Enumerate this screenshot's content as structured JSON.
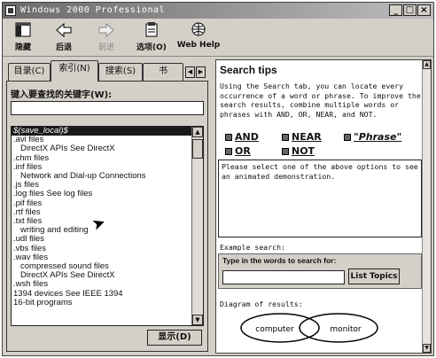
{
  "window": {
    "title": "Windows 2000 Professional",
    "controls": [
      "_",
      "□",
      "×"
    ]
  },
  "toolbar": [
    {
      "label": "隐藏",
      "icon": "hide-pane-icon",
      "enabled": true
    },
    {
      "label": "后退",
      "icon": "back-arrow-icon",
      "enabled": true
    },
    {
      "label": "前进",
      "icon": "forward-arrow-icon",
      "enabled": false
    },
    {
      "label": "选项(O)",
      "icon": "options-icon",
      "enabled": true
    },
    {
      "label": "Web Help",
      "icon": "web-help-icon",
      "enabled": true
    }
  ],
  "tabs": [
    "目录(C)",
    "索引(N)",
    "搜索(S)",
    "书"
  ],
  "index": {
    "keyword_label": "键入要查找的关键字(W):",
    "keyword_value": "",
    "items": [
      {
        "text": "$(save_local)$",
        "level": 0,
        "selected": true
      },
      {
        "text": ".avi files",
        "level": 0
      },
      {
        "text": "DirectX APIs See DirectX",
        "level": 1
      },
      {
        "text": ".chm files",
        "level": 0
      },
      {
        "text": ".inf files",
        "level": 0
      },
      {
        "text": "Network and Dial-up Connections",
        "level": 1
      },
      {
        "text": ".js files",
        "level": 0
      },
      {
        "text": ".log files See log files",
        "level": 0
      },
      {
        "text": ".pif files",
        "level": 0
      },
      {
        "text": ".rtf files",
        "level": 0
      },
      {
        "text": ".txt files",
        "level": 0
      },
      {
        "text": "writing and editing",
        "level": 1
      },
      {
        "text": ".udl files",
        "level": 0
      },
      {
        "text": ".vbs files",
        "level": 0
      },
      {
        "text": ".wav files",
        "level": 0
      },
      {
        "text": "compressed sound files",
        "level": 1
      },
      {
        "text": "DirectX APIs See DirectX",
        "level": 1
      },
      {
        "text": ".wsh files",
        "level": 0
      },
      {
        "text": "1394 devices See IEEE 1394",
        "level": 0
      },
      {
        "text": "16-bit programs",
        "level": 0
      }
    ],
    "display_button": "显示(D)"
  },
  "search_tips": {
    "title": "Search tips",
    "body": "Using the Search tab, you can locate every occurrence of a word or phrase. To improve the search results, combine multiple words or phrases with AND, OR, NEAR, and NOT.",
    "operators": [
      "AND",
      "NEAR",
      "\"Phrase\"",
      "OR",
      "NOT"
    ],
    "demo_text": "Please select one of the above options to see an animated demonstration.",
    "example_label": "Example search:",
    "example_hint": "Type in the words to search for:",
    "example_value": "",
    "list_topics_button": "List Topics",
    "diagram_label": "Diagram of results:",
    "venn_left": "computer",
    "venn_right": "monitor"
  }
}
